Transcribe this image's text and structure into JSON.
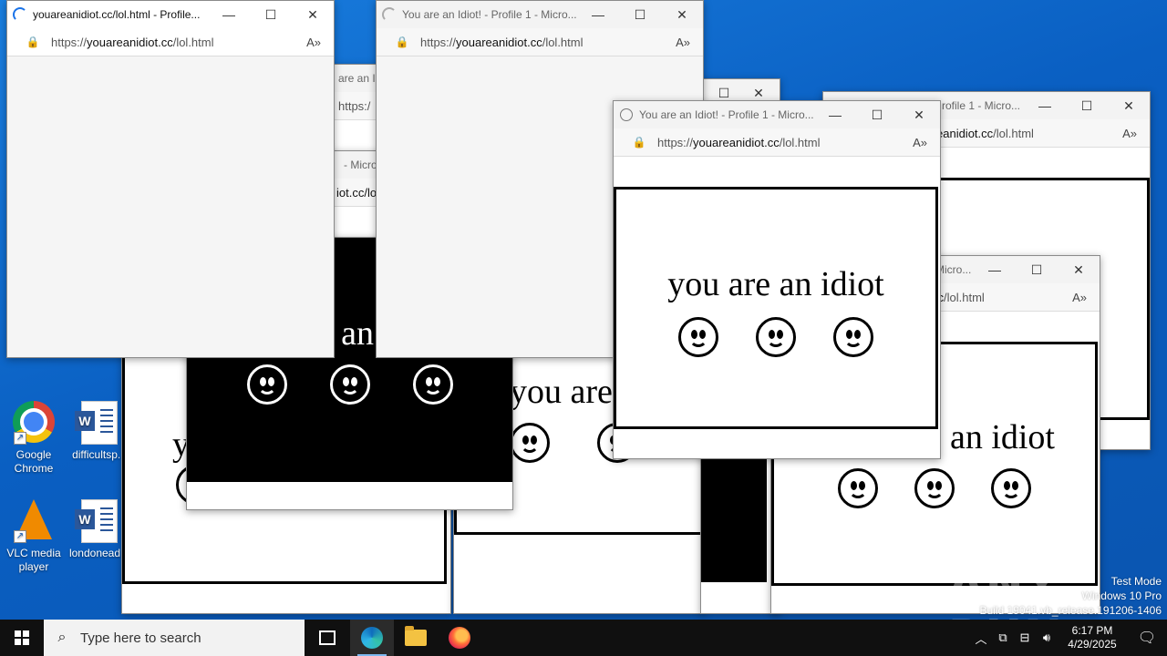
{
  "desktop_icons": [
    {
      "label": "Google Chrome",
      "icon": "chrome-icon"
    },
    {
      "label": "difficultsp...",
      "icon": "word-doc-icon"
    },
    {
      "label": "VLC media player",
      "icon": "vlc-icon"
    },
    {
      "label": "londonead...",
      "icon": "word-doc-icon"
    }
  ],
  "windows": {
    "front_left": {
      "title": "youareanidiot.cc/lol.html - Profile...",
      "url_prefix": "https://",
      "url_domain": "youareanidiot.cc",
      "url_path": "/lol.html"
    },
    "front_mid": {
      "title": "You are an Idiot! - Profile 1 - Micro...",
      "url_prefix": "https://",
      "url_domain": "youareanidiot.cc",
      "url_path": "/lol.html"
    },
    "front_right": {
      "title": "You are an Idiot! - Profile 1 - Micro...",
      "url_prefix": "https://",
      "url_domain": "youareanidiot.cc",
      "url_path": "/lol.html",
      "phrase": "you are an idiot"
    },
    "back_upper_right": {
      "title": "...rofile 1 - Micro...",
      "url_fragment": "eanidiot.cc",
      "url_path": "/lol.html"
    },
    "back_lower_right": {
      "title": "Micro...",
      "url_fragment": "cc",
      "url_path": "/lol.html",
      "phrase": "an idiot"
    },
    "back_left_a": {
      "title_fragment": "are an Id",
      "url_fragment": "https:/"
    },
    "back_left_b": {
      "title_fragment": "- Micro...",
      "url_fragment": "iot.cc/lo"
    },
    "back_black": {
      "phrase": "e an"
    },
    "back_lower_left": {
      "phrase": "y"
    },
    "back_lower_mid": {
      "phrase": "you are"
    }
  },
  "taskbar": {
    "search_placeholder": "Type here to search",
    "time": "6:17 PM",
    "date": "4/29/2025"
  },
  "watermark": {
    "line1": "Test Mode",
    "line2": "Windows 10 Pro",
    "line3": "Build 19041.vb_release.191206-1406",
    "brand": "ANY RUN"
  }
}
